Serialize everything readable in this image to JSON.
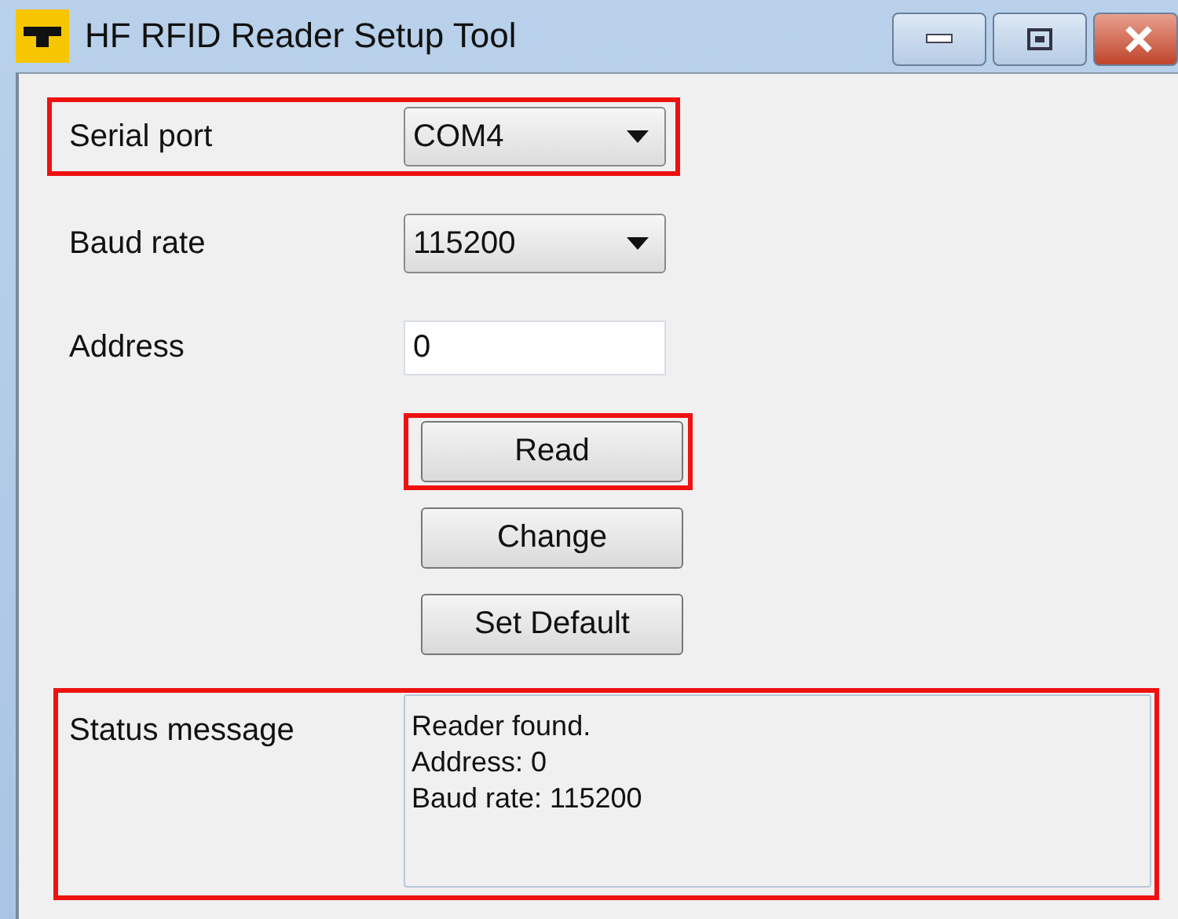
{
  "window": {
    "title": "HF RFID Reader Setup Tool"
  },
  "fields": [
    {
      "kind": "dropdown",
      "label": "Serial port",
      "value": "COM4",
      "highlighted": true
    },
    {
      "kind": "dropdown",
      "label": "Baud rate",
      "value": "115200",
      "highlighted": false
    },
    {
      "kind": "text",
      "label": "Address",
      "value": "0",
      "highlighted": false
    }
  ],
  "buttons": [
    {
      "label": "Read",
      "highlighted": true
    },
    {
      "label": "Change",
      "highlighted": false
    },
    {
      "label": "Set Default",
      "highlighted": false
    }
  ],
  "status": {
    "label": "Status message",
    "lines": [
      "Reader found.",
      "Address: 0",
      "Baud rate: 115200"
    ],
    "highlighted": true
  }
}
